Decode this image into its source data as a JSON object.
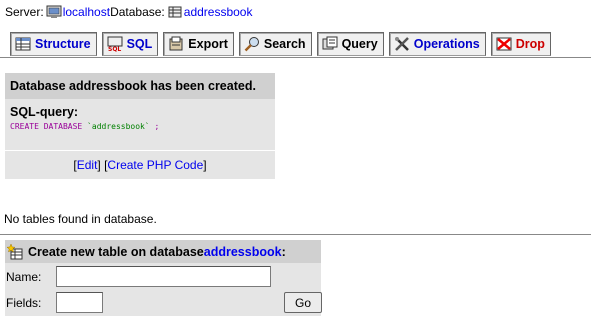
{
  "breadcrumb": {
    "server_label": "Server:",
    "server_name": "localhost",
    "database_label": "Database:",
    "database_name": "addressbook"
  },
  "tabs": [
    {
      "label": "Structure",
      "icon": "structure-icon"
    },
    {
      "label": "SQL",
      "icon": "sql-icon"
    },
    {
      "label": "Export",
      "icon": "export-icon"
    },
    {
      "label": "Search",
      "icon": "search-icon"
    },
    {
      "label": "Query",
      "icon": "query-icon"
    },
    {
      "label": "Operations",
      "icon": "operations-icon"
    },
    {
      "label": "Drop",
      "icon": "drop-icon"
    }
  ],
  "notice": {
    "message": "Database addressbook has been created.",
    "sql_label": "SQL-query:",
    "sql_keyword": "CREATE DATABASE ",
    "sql_db": "`addressbook`",
    "sql_end": " ;",
    "edit_open": "[",
    "edit_link": "Edit",
    "edit_close": "] [",
    "php_link": "Create PHP Code",
    "php_close": "]"
  },
  "no_tables_text": "No tables found in database.",
  "create_table": {
    "title_prefix": "Create new table on database ",
    "database_link": "addressbook",
    "title_suffix": ":",
    "name_label": "Name:",
    "name_value": "",
    "fields_label": "Fields:",
    "fields_value": "",
    "go_button": "Go"
  },
  "colors": {
    "link": "#0000ee",
    "drop": "#cc0000",
    "notice_bg": "#e5e5e5",
    "notice_head_bg": "#d0d0d0"
  }
}
